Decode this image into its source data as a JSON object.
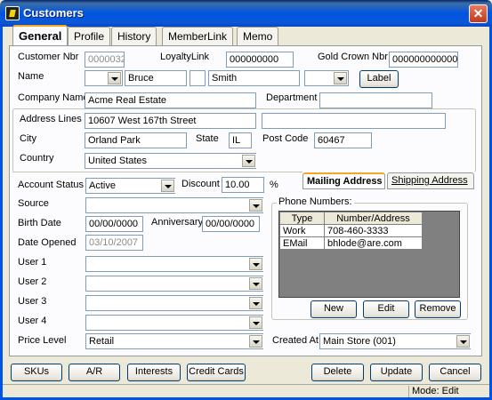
{
  "window": {
    "title": "Customers",
    "close_label": "✕"
  },
  "tabs": [
    "General",
    "Profile",
    "History",
    "MemberLink",
    "Memo"
  ],
  "customer_nbr": {
    "label": "Customer Nbr",
    "value": "0000032"
  },
  "loyalty_link": {
    "label": "LoyaltyLink",
    "value": "000000000"
  },
  "gold_crown_nbr": {
    "label": "Gold Crown Nbr",
    "value": "000000000000"
  },
  "name": {
    "label": "Name",
    "first": "Bruce",
    "last": "Smith",
    "label_button": "Label"
  },
  "company_name": {
    "label": "Company Name",
    "value": "Acme Real Estate"
  },
  "department": {
    "label": "Department",
    "value": ""
  },
  "address": {
    "lines_label": "Address Lines",
    "line1": "10607 West 167th Street",
    "line2": "",
    "city_label": "City",
    "city": "Orland Park",
    "state_label": "State",
    "state": "IL",
    "post_code_label": "Post Code",
    "post_code": "60467",
    "country_label": "Country",
    "country": "United States"
  },
  "address_tabs": [
    "Mailing Address",
    "Shipping Address"
  ],
  "account_status": {
    "label": "Account Status",
    "value": "Active"
  },
  "discount": {
    "label": "Discount",
    "value": "10.00",
    "unit": "%"
  },
  "source": {
    "label": "Source",
    "value": ""
  },
  "birth_date": {
    "label": "Birth Date",
    "value": "00/00/0000"
  },
  "anniversary": {
    "label": "Anniversary",
    "value": "00/00/0000"
  },
  "date_opened": {
    "label": "Date Opened",
    "value": "03/10/2007"
  },
  "user_fields": [
    {
      "label": "User 1",
      "value": ""
    },
    {
      "label": "User 2",
      "value": ""
    },
    {
      "label": "User 3",
      "value": ""
    },
    {
      "label": "User 4",
      "value": ""
    }
  ],
  "price_level": {
    "label": "Price Level",
    "value": "Retail"
  },
  "phone_numbers": {
    "label": "Phone Numbers:",
    "headers": [
      "Type",
      "Number/Address"
    ],
    "rows": [
      {
        "type": "Work",
        "value": "708-460-3333"
      },
      {
        "type": "EMail",
        "value": "bhlode@are.com"
      }
    ],
    "buttons": {
      "new": "New",
      "edit": "Edit",
      "remove": "Remove"
    }
  },
  "created_at": {
    "label": "Created At",
    "value": "Main Store (001)"
  },
  "bottom_buttons": {
    "skus": "SKUs",
    "ar": "A/R",
    "interests": "Interests",
    "credit_cards": "Credit Cards",
    "delete": "Delete",
    "update": "Update",
    "cancel": "Cancel"
  },
  "status": {
    "mode": "Mode: Edit"
  },
  "colors": {
    "title_bar": "#0054e3",
    "window_bg": "#ece9d8",
    "active_tab_accent": "#f5a623"
  }
}
